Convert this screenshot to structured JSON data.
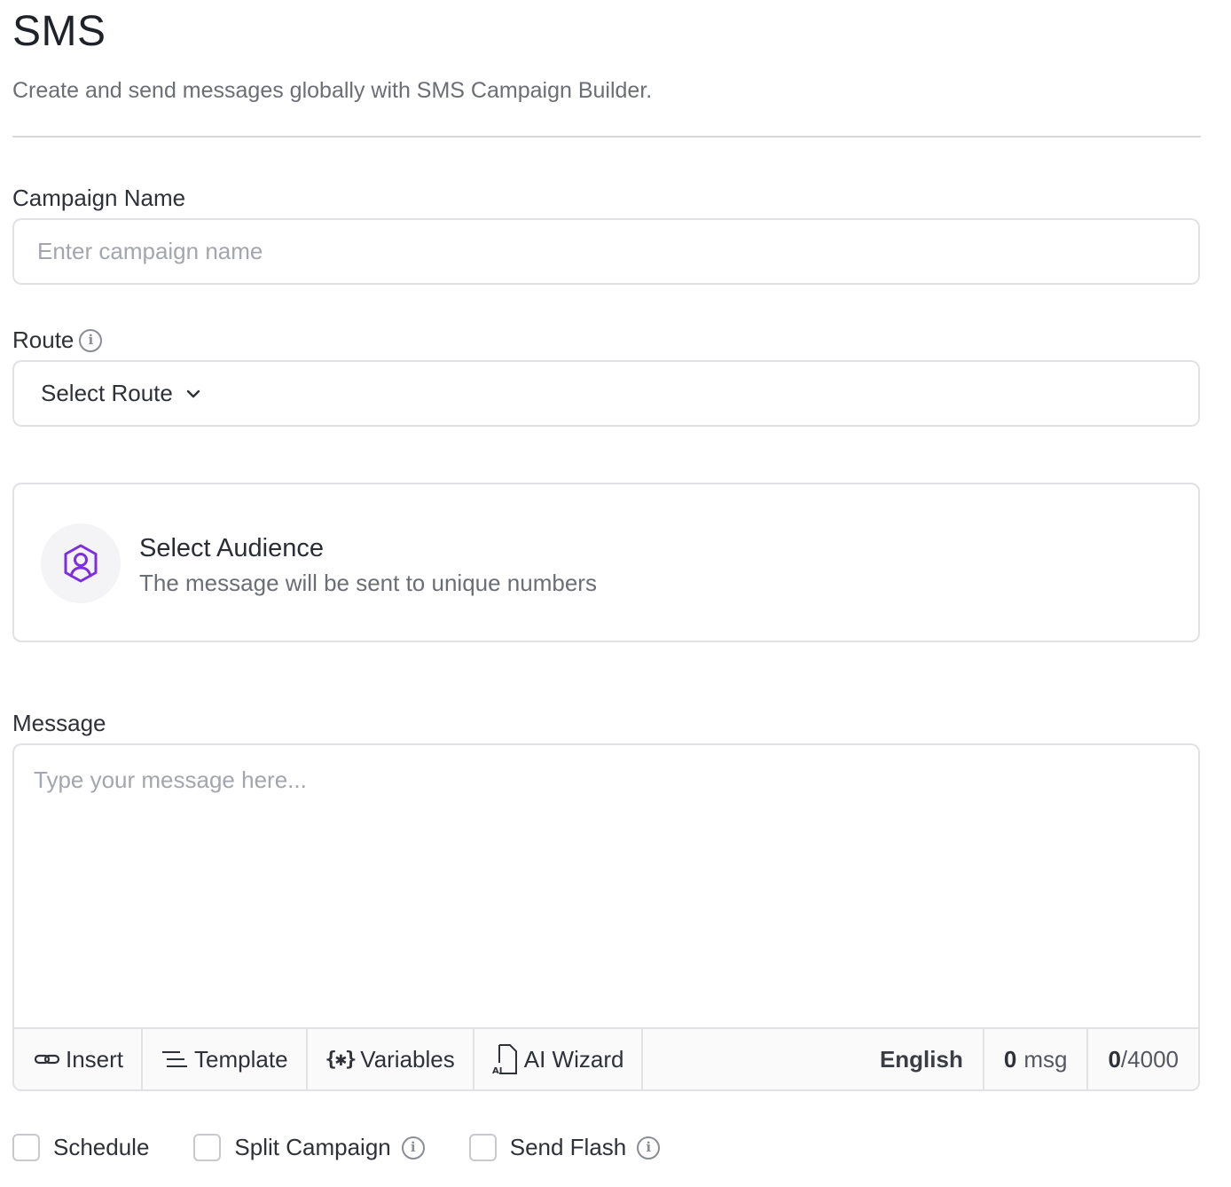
{
  "header": {
    "title": "SMS",
    "subtitle": "Create and send messages globally with SMS Campaign Builder."
  },
  "campaign_name": {
    "label": "Campaign Name",
    "value": "",
    "placeholder": "Enter campaign name"
  },
  "route": {
    "label": "Route",
    "selected": "Select Route",
    "info_icon": "info-icon",
    "dropdown_icon": "chevron-down-icon"
  },
  "audience": {
    "title": "Select Audience",
    "description": "The message will be sent to unique numbers",
    "icon": "user-hexagon-icon",
    "icon_color": "#7c2ee0"
  },
  "message": {
    "label": "Message",
    "value": "",
    "placeholder": "Type your message here...",
    "toolbar": {
      "insert_label": "Insert",
      "template_label": "Template",
      "variables_label": "Variables",
      "ai_wizard_label": "AI Wizard",
      "language": "English",
      "msg_count": "0",
      "msg_unit": "msg",
      "char_count": "0",
      "char_limit": "/4000"
    }
  },
  "options": {
    "schedule_label": "Schedule",
    "schedule_checked": false,
    "split_campaign_label": "Split Campaign",
    "split_campaign_checked": false,
    "send_flash_label": "Send Flash",
    "send_flash_checked": false
  }
}
